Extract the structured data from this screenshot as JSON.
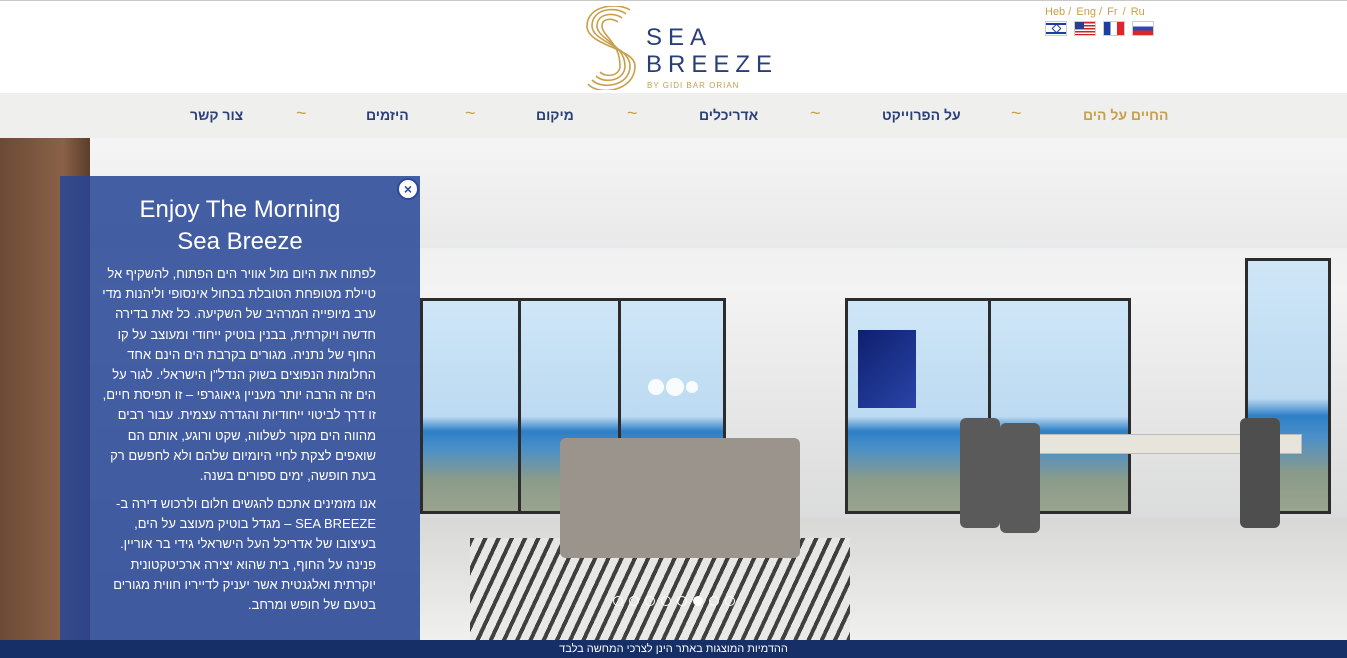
{
  "brand": {
    "word1": "SEA",
    "word2": "BREEZE",
    "byline": "BY GIDI BAR ORIAN",
    "gold": "#c8a04a",
    "navy": "#2a3f7a"
  },
  "languages": {
    "links": [
      "Heb /",
      "Eng /",
      "Fr",
      "/",
      "Ru"
    ],
    "flags": [
      "israel-flag-icon",
      "usa-flag-icon",
      "france-flag-icon",
      "russia-flag-icon"
    ]
  },
  "nav": {
    "items": [
      {
        "label": "החיים על הים",
        "active": true
      },
      {
        "label": "על הפרוייקט",
        "active": false
      },
      {
        "label": "אדריכלים",
        "active": false
      },
      {
        "label": "מיקום",
        "active": false
      },
      {
        "label": "היזמים",
        "active": false
      },
      {
        "label": "צור קשר",
        "active": false
      }
    ],
    "separator": "~"
  },
  "panel": {
    "title_line1": "Enjoy The Morning",
    "title_line2": "Sea Breeze",
    "close_glyph": "×",
    "paragraph1": "לפתוח את היום מול אוויר הים הפתוח, להשקיף אל טיילת מטופחת הטובלת בכחול אינסופי וליהנות מדי ערב מיופייה המרהיב של השקיעה. כל זאת בדירה חדשה ויוקרתית, בבנין בוטיק ייחודי ומעוצב על קו החוף של נתניה. מגורים בקרבת הים הינם אחד החלומות הנפוצים בשוק הנדל\"ן הישראלי. לגור על הים זה הרבה יותר מעניין גיאוגרפי – זו תפיסת חיים, זו דרך לביטוי ייחודיות והגדרה עצמית. עבור רבים מהווה הים מקור לשלווה, שקט ורוגע, אותם הם שואפים לצקת לחיי היומיום שלהם ולא לחפשם רק בעת חופשה, ימים ספורים בשנה.",
    "paragraph2": "אנו מזמינים אתכם להגשים חלום ולרכוש דירה ב- SEA BREEZE – מגדל בוטיק מעוצב על הים, בעיצובו של אדריכל העל הישראלי גידי בר אוריין. פנינה על החוף, בית שהוא יצירה ארכיטקטונית יוקרתית ואלגנטית אשר יעניק לדייריו חווית מגורים בטעם של חופש ומרחב."
  },
  "slider": {
    "count": 8,
    "active_index": 5
  },
  "footer": {
    "disclaimer": "ההדמיות המוצגות באתר הינן לצרכי המחשה בלבד"
  }
}
